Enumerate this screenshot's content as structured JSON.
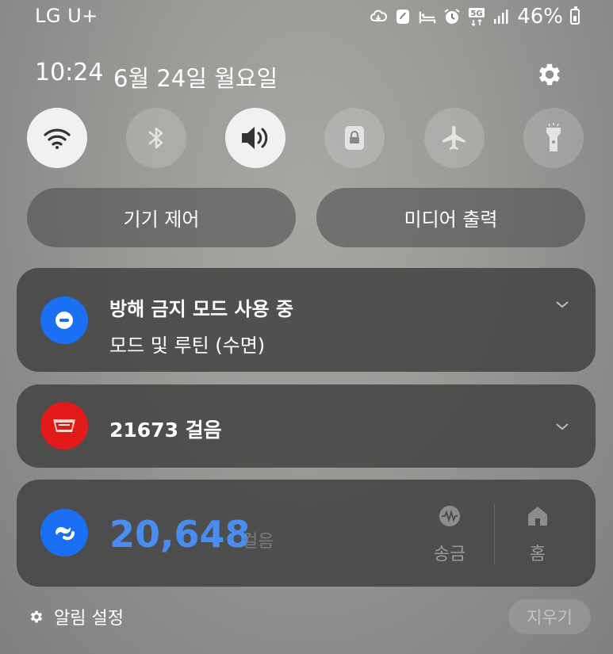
{
  "status_bar": {
    "carrier": "LG U+",
    "network": "5G",
    "battery_percent": "46%",
    "icons": [
      "cloud-sync-icon",
      "app-notification-icon",
      "sleep-icon",
      "alarm-icon",
      "network-5g-icon",
      "signal-icon",
      "battery-icon"
    ]
  },
  "header": {
    "time": "10:24",
    "date": "6월 24일 월요일",
    "settings_icon": "gear-icon"
  },
  "quick_settings": [
    {
      "name": "wifi",
      "icon": "wifi-icon",
      "active": true
    },
    {
      "name": "bluetooth",
      "icon": "bluetooth-icon",
      "active": false
    },
    {
      "name": "sound",
      "icon": "speaker-icon",
      "active": true
    },
    {
      "name": "screen-lock",
      "icon": "lock-icon",
      "active": false
    },
    {
      "name": "airplane-mode",
      "icon": "airplane-icon",
      "active": false
    },
    {
      "name": "flashlight",
      "icon": "flashlight-icon",
      "active": false
    }
  ],
  "buttons": {
    "device_control": "기기 제어",
    "media_output": "미디어 출력"
  },
  "notifications": {
    "dnd": {
      "title": "방해 금지 모드 사용 중",
      "subtitle": "모드 및 루틴 (수면)",
      "icon": "do-not-disturb-icon",
      "color": "#1a6ff2"
    },
    "steps": {
      "title": "21673 걸음",
      "icon": "cashwalk-app-icon",
      "color": "#e21a1a"
    },
    "toss": {
      "count": "20,648",
      "unit": "걸음",
      "icon": "toss-app-icon",
      "color": "#1a6ff2",
      "accent": "#4a8df0",
      "actions": [
        {
          "label": "송금",
          "icon": "transfer-icon"
        },
        {
          "label": "홈",
          "icon": "home-icon"
        }
      ]
    }
  },
  "footer": {
    "notification_settings": "알림 설정",
    "clear": "지우기"
  }
}
